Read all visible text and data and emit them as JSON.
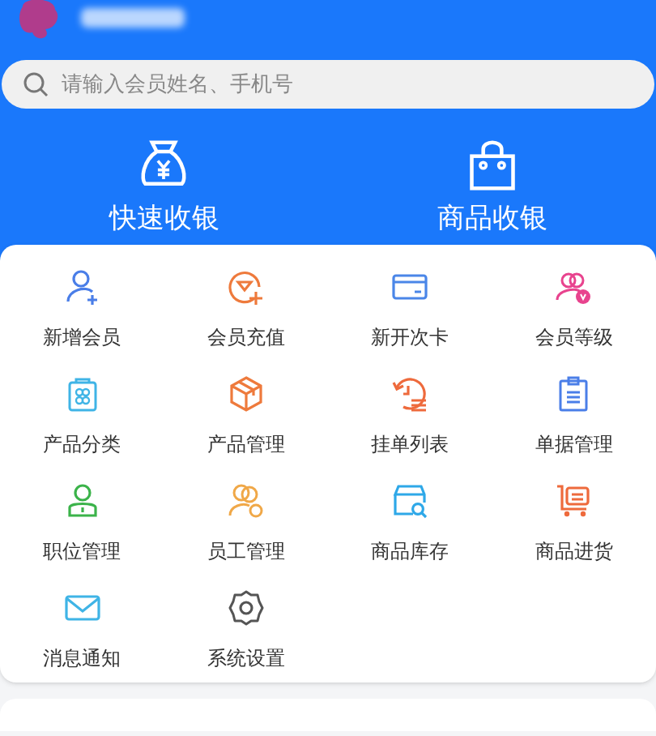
{
  "search": {
    "placeholder": "请输入会员姓名、手机号"
  },
  "quick_actions": [
    {
      "kind": "money-bag",
      "label": "快速收银"
    },
    {
      "kind": "shopping-bag",
      "label": "商品收银"
    }
  ],
  "menu": [
    {
      "kind": "user-add",
      "label": "新增会员",
      "color": "#4a7ee8"
    },
    {
      "kind": "diamond-add",
      "label": "会员充值",
      "color": "#ee7a3c"
    },
    {
      "kind": "card",
      "label": "新开次卡",
      "color": "#4a86e8"
    },
    {
      "kind": "user-vip",
      "label": "会员等级",
      "color": "#e8438e"
    },
    {
      "kind": "grid-bag",
      "label": "产品分类",
      "color": "#3fb4e6"
    },
    {
      "kind": "box",
      "label": "产品管理",
      "color": "#ee7a3c"
    },
    {
      "kind": "history",
      "label": "挂单列表",
      "color": "#ee6a3c"
    },
    {
      "kind": "clipboard",
      "label": "单据管理",
      "color": "#4a7ee8"
    },
    {
      "kind": "badge-user",
      "label": "职位管理",
      "color": "#3bb34a"
    },
    {
      "kind": "users-gear",
      "label": "员工管理",
      "color": "#f0a848"
    },
    {
      "kind": "store-search",
      "label": "商品库存",
      "color": "#2ea8e8"
    },
    {
      "kind": "cart",
      "label": "商品进货",
      "color": "#ee6a3c"
    },
    {
      "kind": "mail",
      "label": "消息通知",
      "color": "#3fb4e6"
    },
    {
      "kind": "gear",
      "label": "系统设置",
      "color": "#555555"
    }
  ]
}
